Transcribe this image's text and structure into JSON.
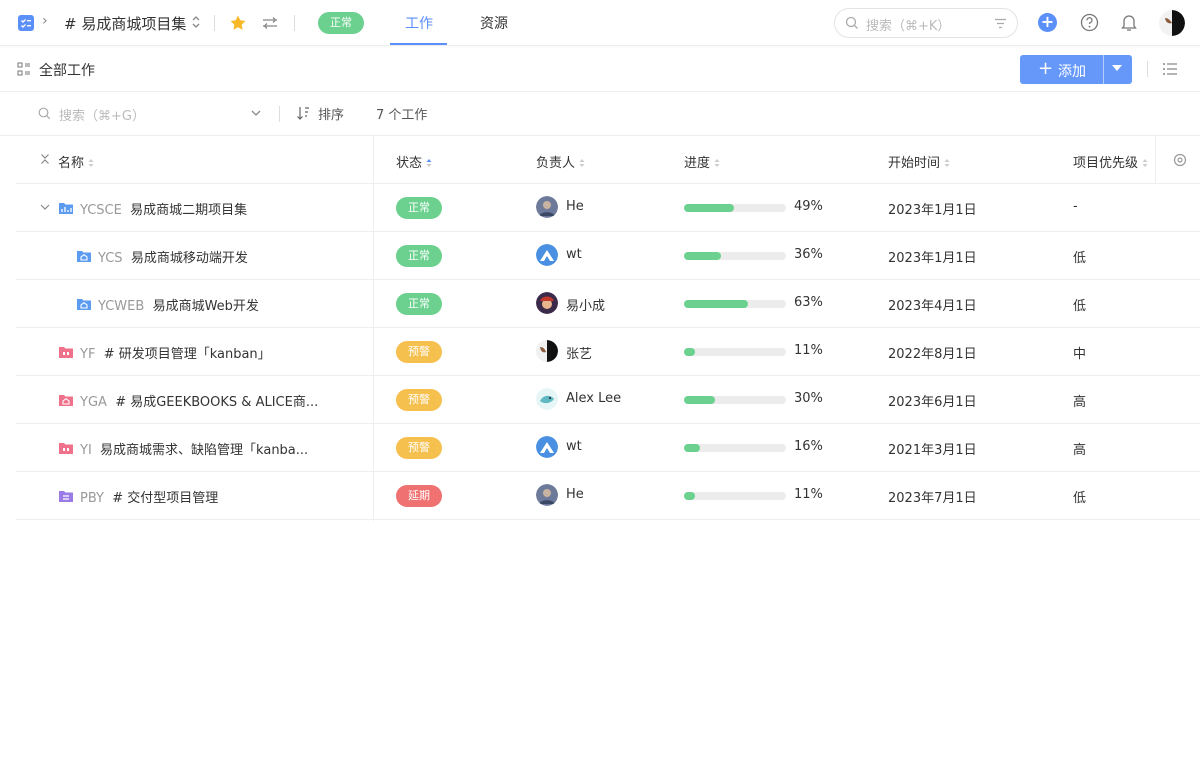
{
  "header": {
    "project_title": "# 易成商城项目集",
    "status": "正常",
    "tabs": [
      {
        "label": "工作",
        "active": true
      },
      {
        "label": "资源",
        "active": false
      }
    ],
    "search_placeholder": "搜索（⌘+K）",
    "accent_color": "#5b8ff9"
  },
  "toolbar": {
    "title": "全部工作",
    "add_label": "添加"
  },
  "filter": {
    "search_placeholder": "搜索（⌘+G）",
    "sort_label": "排序",
    "count_label": "7 个工作"
  },
  "table": {
    "columns": [
      "名称",
      "状态",
      "负责人",
      "进度",
      "开始时间",
      "项目优先级"
    ],
    "rows": [
      {
        "code": "YCSCE",
        "name": "易成商城二期项目集",
        "status": "正常",
        "status_color": "#6cd08f",
        "owner": "He",
        "progress": 49,
        "progress_label": "49%",
        "start": "2023年1月1日",
        "priority": "-",
        "icon": "folder-chart-icon",
        "icon_color": "#5b9cf0",
        "level": 0,
        "expanded": true
      },
      {
        "code": "YCS",
        "name": "易成商城移动端开发",
        "status": "正常",
        "status_color": "#6cd08f",
        "owner": "wt",
        "progress": 36,
        "progress_label": "36%",
        "start": "2023年1月1日",
        "priority": "低",
        "icon": "folder-home-icon",
        "icon_color": "#5b9cf0",
        "level": 1
      },
      {
        "code": "YCWEB",
        "name": "易成商城Web开发",
        "status": "正常",
        "status_color": "#6cd08f",
        "owner": "易小成",
        "progress": 63,
        "progress_label": "63%",
        "start": "2023年4月1日",
        "priority": "低",
        "icon": "folder-home-icon",
        "icon_color": "#5b9cf0",
        "level": 1
      },
      {
        "code": "YF",
        "name": "# 研发项目管理「kanban」",
        "status": "预警",
        "status_color": "#f5c04e",
        "owner": "张艺",
        "progress": 11,
        "progress_label": "11%",
        "start": "2022年8月1日",
        "priority": "中",
        "icon": "folder-kanban-icon",
        "icon_color": "#f0718a",
        "level": 0
      },
      {
        "code": "YGA",
        "name": "# 易成GEEKBOOKS & ALICE商...",
        "status": "预警",
        "status_color": "#f5c04e",
        "owner": "Alex Lee",
        "progress": 30,
        "progress_label": "30%",
        "start": "2023年6月1日",
        "priority": "高",
        "icon": "folder-home-icon",
        "icon_color": "#f0718a",
        "level": 0
      },
      {
        "code": "YI",
        "name": "易成商城需求、缺陷管理「kanba...",
        "status": "预警",
        "status_color": "#f5c04e",
        "owner": "wt",
        "progress": 16,
        "progress_label": "16%",
        "start": "2021年3月1日",
        "priority": "高",
        "icon": "folder-kanban-icon",
        "icon_color": "#f0718a",
        "level": 0
      },
      {
        "code": "PBY",
        "name": "# 交付型项目管理",
        "status": "延期",
        "status_color": "#f07171",
        "owner": "He",
        "progress": 11,
        "progress_label": "11%",
        "start": "2023年7月1日",
        "priority": "低",
        "icon": "folder-list-icon",
        "icon_color": "#9b7be6",
        "level": 0
      }
    ]
  }
}
